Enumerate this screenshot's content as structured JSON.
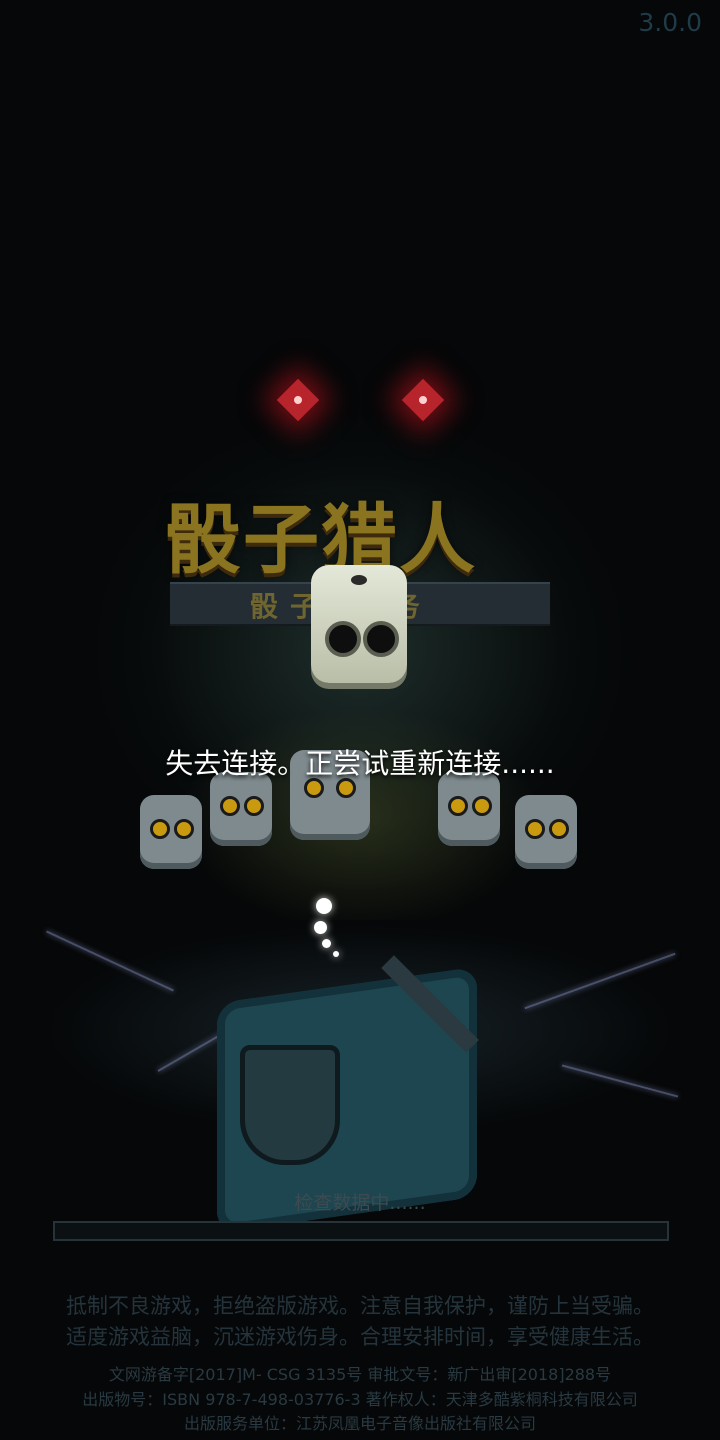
{
  "app": {
    "version": "3.0.0",
    "logo": {
      "title": "骰子猎人",
      "subtitle": "骰子  任务"
    }
  },
  "overlay": {
    "reconnect_message": "失去连接。正尝试重新连接......"
  },
  "loading": {
    "status_text": "检查数据中......",
    "progress_fraction": 0.0
  },
  "health_notice": {
    "line1": "抵制不良游戏，拒绝盗版游戏。注意自我保护，谨防上当受骗。",
    "line2": "适度游戏益脑，沉迷游戏伤身。合理安排时间，享受健康生活。"
  },
  "legal": {
    "line1": "文网游备字[2017]M- CSG 3135号   审批文号：新广出审[2018]288号",
    "line2": "出版物号：ISBN 978-7-498-03776-3   著作权人：天津多酷紫桐科技有限公司",
    "line3": "出版服务单位：江苏凤凰电子音像出版社有限公司"
  },
  "colors": {
    "background": "#050708",
    "eye_red": "#b7242c",
    "logo_gold": "#8a7420"
  },
  "icons": [
    "red-eye-icon",
    "dice-icon",
    "sword-icon",
    "shield-icon"
  ]
}
